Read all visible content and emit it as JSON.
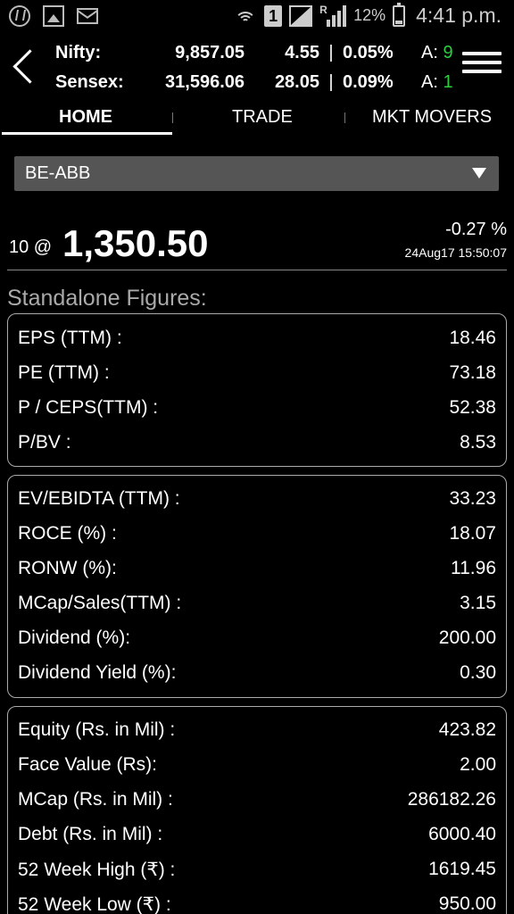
{
  "status_bar": {
    "battery": "12%",
    "time": "4:41 p.m.",
    "sim_slot": "1",
    "network_letter": "R",
    "icons": [
      "app-icon",
      "image-icon",
      "mail-icon",
      "wifi-icon",
      "sim-icon",
      "signal-icon",
      "battery-icon"
    ]
  },
  "indices": [
    {
      "name": "Nifty:",
      "value": "9,857.05",
      "change": "4.55",
      "sep": "|",
      "pct": "0.05%",
      "adv_label": "A:",
      "adv_value": "9"
    },
    {
      "name": "Sensex:",
      "value": "31,596.06",
      "change": "28.05",
      "sep": "|",
      "pct": "0.09%",
      "adv_label": "A:",
      "adv_value": "1"
    }
  ],
  "tabs": [
    {
      "label": "HOME",
      "active": true
    },
    {
      "label": "TRADE",
      "active": false
    },
    {
      "label": "MKT MOVERS",
      "active": false
    }
  ],
  "selector": {
    "value": "BE-ABB"
  },
  "quote": {
    "qty": "10 @",
    "price": "1,350.50",
    "change_pct": "-0.27 %",
    "timestamp": "24Aug17 15:50:07"
  },
  "section_title": "Standalone Figures:",
  "card1": [
    {
      "label": "EPS (TTM) :",
      "value": "18.46"
    },
    {
      "label": "PE (TTM) :",
      "value": "73.18"
    },
    {
      "label": "P / CEPS(TTM) :",
      "value": "52.38"
    },
    {
      "label": "P/BV :",
      "value": "8.53"
    }
  ],
  "card2": [
    {
      "label": "EV/EBIDTA (TTM) :",
      "value": "33.23"
    },
    {
      "label": "ROCE (%) :",
      "value": "18.07"
    },
    {
      "label": "RONW (%):",
      "value": "11.96"
    },
    {
      "label": "MCap/Sales(TTM) :",
      "value": "3.15"
    },
    {
      "label": "Dividend (%):",
      "value": "200.00"
    },
    {
      "label": "Dividend Yield (%):",
      "value": "0.30"
    }
  ],
  "card3": [
    {
      "label": "Equity (Rs. in Mil) :",
      "value": "423.82"
    },
    {
      "label": "Face Value (Rs):",
      "value": "2.00"
    },
    {
      "label": "MCap (Rs. in Mil) :",
      "value": "286182.26"
    },
    {
      "label": "Debt (Rs. in Mil) :",
      "value": "6000.40"
    },
    {
      "label": "52 Week High (₹) :",
      "value": "1619.45"
    },
    {
      "label": "52 Week Low (₹) :",
      "value": "950.00"
    }
  ],
  "colors": {
    "background": "#000000",
    "advance_green": "#2ecc40",
    "selector_bg": "#555555"
  }
}
